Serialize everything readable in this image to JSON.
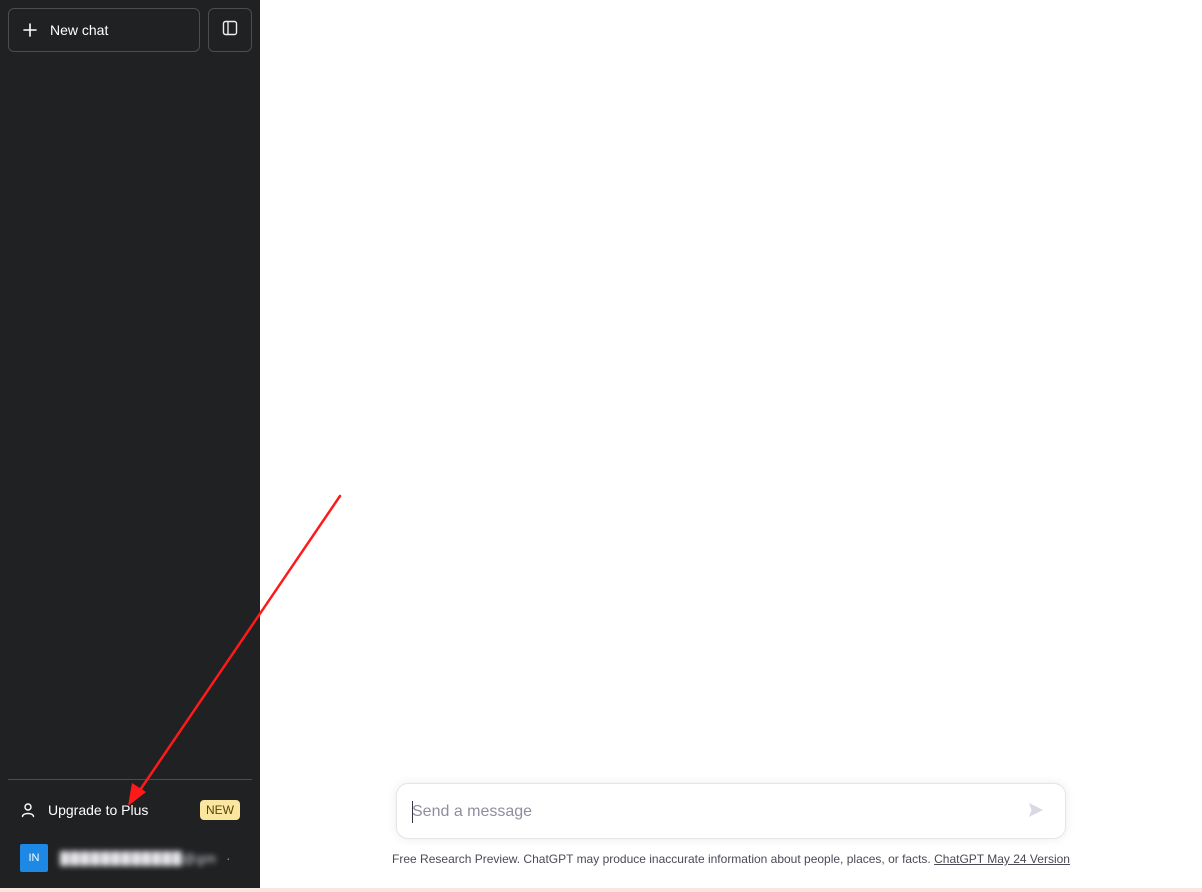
{
  "sidebar": {
    "new_chat_label": "New chat",
    "new_chat_icon": "plus-icon",
    "toggle_icon": "sidebar-toggle-icon",
    "upgrade_label": "Upgrade to Plus",
    "upgrade_icon": "user-icon",
    "upgrade_badge": "NEW",
    "account": {
      "avatar_initials": "IN",
      "email_masked": "████████████@gmail.com",
      "menu_icon": "ellipsis-icon"
    }
  },
  "composer": {
    "placeholder": "Send a message",
    "send_icon": "send-icon"
  },
  "footer": {
    "note": "Free Research Preview. ChatGPT may produce inaccurate information about people, places, or facts. ",
    "version_link": "ChatGPT May 24 Version"
  },
  "colors": {
    "sidebar_bg": "#202123",
    "badge_bg": "#fae69e",
    "avatar_bg": "#1e88e5",
    "annotation_arrow": "#ff1a1a"
  }
}
